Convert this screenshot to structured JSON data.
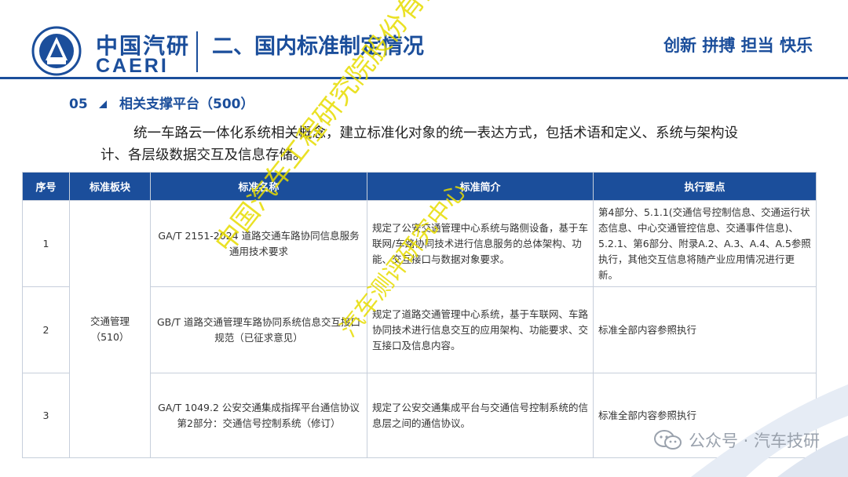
{
  "header": {
    "brand_cn": "中国汽研",
    "brand_en": "CAERI",
    "page_title": "二、国内标准制定情况",
    "slogan": "创新 拼搏 担当 快乐"
  },
  "section": {
    "number": "05",
    "title": "相关支撑平台（500）"
  },
  "intro_text": "统一车路云一体化系统相关概念，建立标准化对象的统一表达方式，包括术语和定义、系统与架构设计、各层级数据交互及信息存储。",
  "table": {
    "headers": [
      "序号",
      "标准板块",
      "标准名称",
      "标准简介",
      "执行要点"
    ],
    "merged_block": "交通管理\n（510）",
    "rows": [
      {
        "no": "1",
        "name": "GA/T 2151-2024 道路交通车路协同信息服务通用技术要求",
        "intro": "规定了公安交通管理中心系统与路侧设备，基于车联网/车路协同技术进行信息服务的总体架构、功能、交互接口与数据对象要求。",
        "points": "第4部分、5.1.1(交通信号控制信息、交通运行状态信息、中心交通管控信息、交通事件信息)、5.2.1、第6部分、附录A.2、A.3、A.4、A.5参照执行，其他交互信息将随产业应用情况进行更新。"
      },
      {
        "no": "2",
        "name": "GB/T 道路交通管理车路协同系统信息交互接口规范（已征求意见）",
        "intro": "规定了道路交通管理中心系统，基于车联网、车路协同技术进行信息交互的应用架构、功能要求、交互接口及信息内容。",
        "points": "标准全部内容参照执行"
      },
      {
        "no": "3",
        "name": "GA/T 1049.2 公安交通集成指挥平台通信协议 第2部分：交通信号控制系统（修订）",
        "intro": "规定了公安交通集成平台与交通信号控制系统的信息层之间的通信协议。",
        "points": "标准全部内容参照执行"
      }
    ]
  },
  "watermark": {
    "line1": "中国汽车工程研究院股份有限公司",
    "line2": "汽车测评研究中心"
  },
  "wechat_label": "公众号 · 汽车技研",
  "colors": {
    "brand": "#1b4e9b",
    "watermark": "#e7dc00"
  }
}
